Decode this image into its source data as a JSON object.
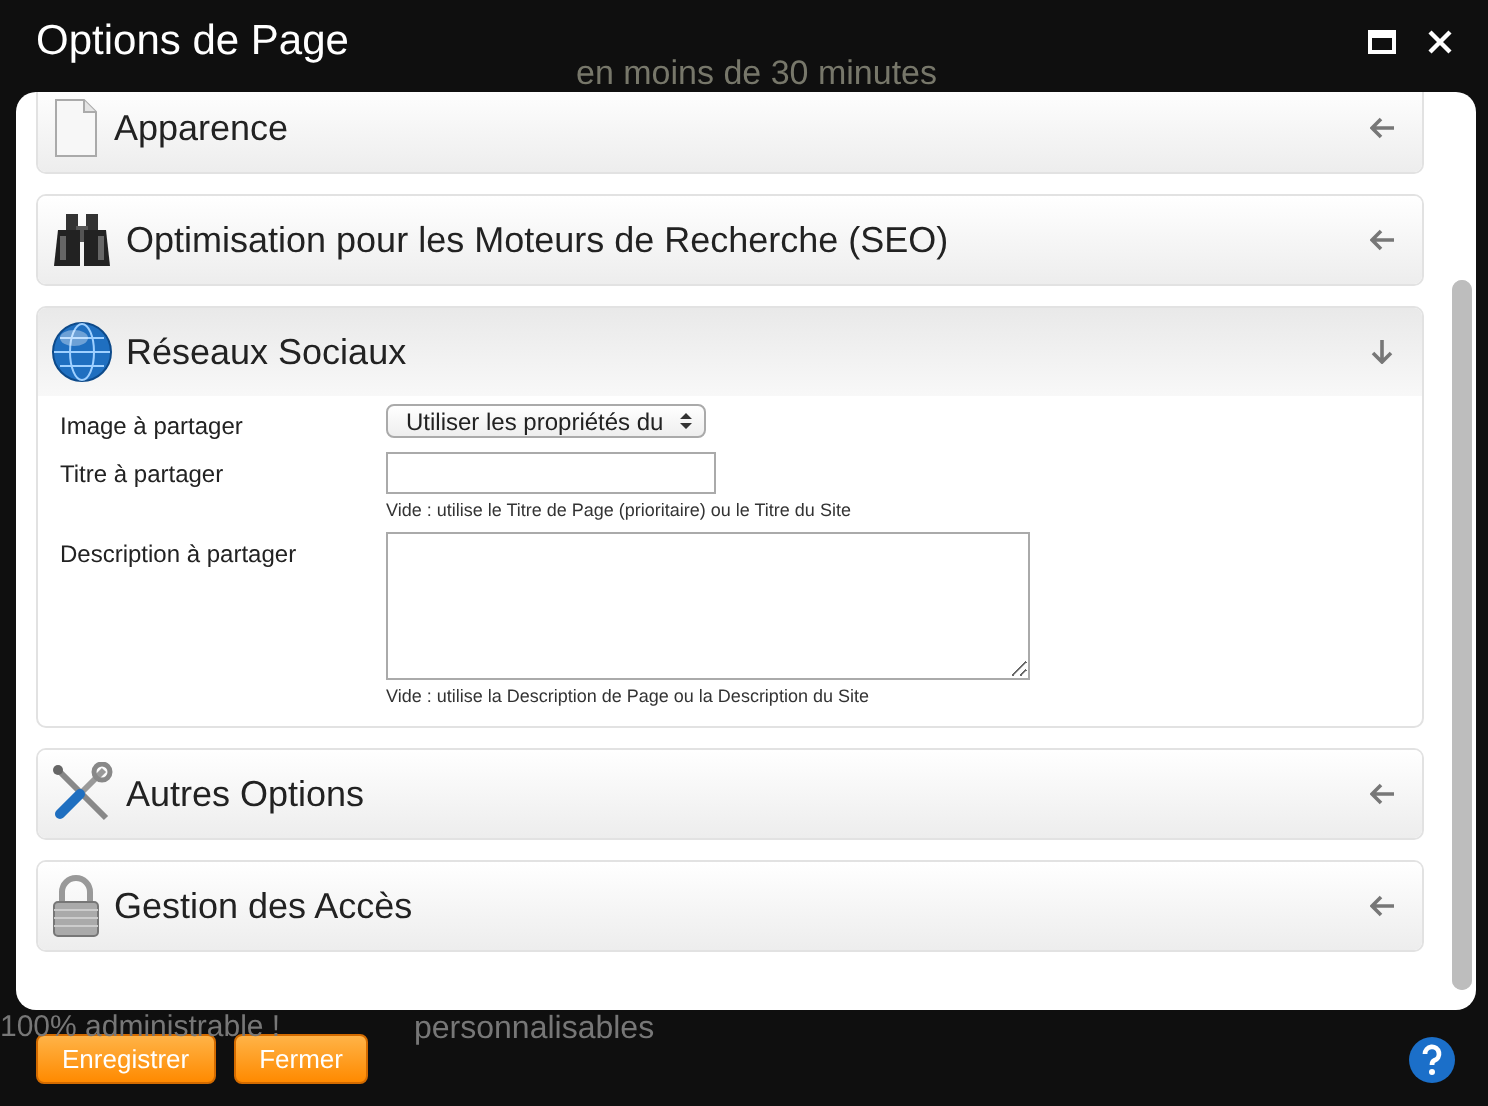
{
  "background_page": {
    "headline_fragment": "en moins de 30 minutes",
    "left_text": "100% administrable !",
    "right_text": "personnalisables"
  },
  "dialog": {
    "title": "Options de Page"
  },
  "sections": [
    {
      "title": "Apparence",
      "expanded": false
    },
    {
      "title": "Optimisation pour les Moteurs de Recherche (SEO)",
      "expanded": false
    },
    {
      "title": "Réseaux Sociaux",
      "expanded": true,
      "fields": [
        {
          "kind": "select",
          "label": "Image à partager",
          "value": "Utiliser les propriétés du"
        },
        {
          "kind": "text",
          "label": "Titre à partager",
          "hint": "Vide : utilise le Titre de Page (prioritaire) ou le Titre du Site"
        },
        {
          "kind": "textarea",
          "label": "Description à partager",
          "hint": "Vide : utilise la Description de Page ou la Description du Site"
        }
      ]
    },
    {
      "title": "Autres Options",
      "expanded": false
    },
    {
      "title": "Gestion des Accès",
      "expanded": false
    }
  ],
  "buttons": [
    "Enregistrer",
    "Fermer"
  ]
}
